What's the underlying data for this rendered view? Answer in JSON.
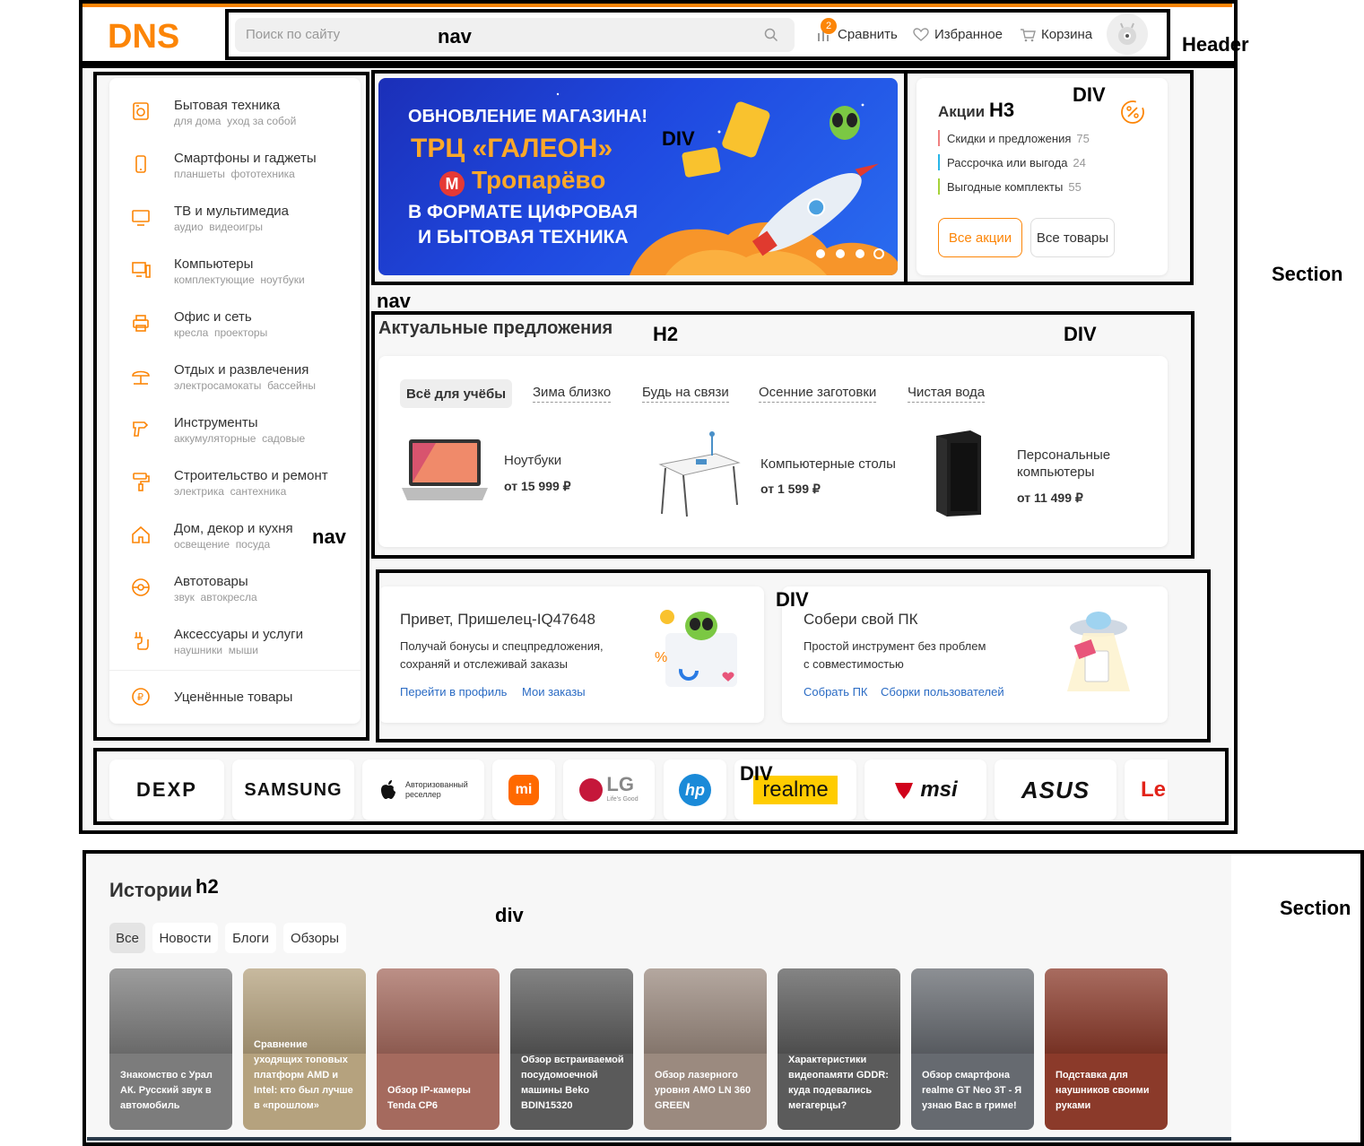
{
  "header": {
    "logo_text": "DNS",
    "search_placeholder": "Поиск по сайту",
    "compare_label": "Сравнить",
    "compare_count": "2",
    "favorites_label": "Избранное",
    "cart_label": "Корзина"
  },
  "catalog": {
    "items": [
      {
        "title": "Бытовая техника",
        "sub1": "для дома",
        "sub2": "уход за собой",
        "icon": "washing-machine-icon"
      },
      {
        "title": "Смартфоны и гаджеты",
        "sub1": "планшеты",
        "sub2": "фототехника",
        "icon": "smartphone-icon"
      },
      {
        "title": "ТВ и мультимедиа",
        "sub1": "аудио",
        "sub2": "видеоигры",
        "icon": "tv-icon"
      },
      {
        "title": "Компьютеры",
        "sub1": "комплектующие",
        "sub2": "ноутбуки",
        "icon": "computer-icon"
      },
      {
        "title": "Офис и сеть",
        "sub1": "кресла",
        "sub2": "проекторы",
        "icon": "printer-icon"
      },
      {
        "title": "Отдых и развлечения",
        "sub1": "электросамокаты",
        "sub2": "бассейны",
        "icon": "umbrella-icon"
      },
      {
        "title": "Инструменты",
        "sub1": "аккумуляторные",
        "sub2": "садовые",
        "icon": "drill-icon"
      },
      {
        "title": "Строительство и ремонт",
        "sub1": "электрика",
        "sub2": "сантехника",
        "icon": "paint-roller-icon"
      },
      {
        "title": "Дом, декор и кухня",
        "sub1": "освещение",
        "sub2": "посуда",
        "icon": "house-icon"
      },
      {
        "title": "Автотовары",
        "sub1": "звук",
        "sub2": "автокресла",
        "icon": "steering-wheel-icon"
      },
      {
        "title": "Аксессуары и услуги",
        "sub1": "наушники",
        "sub2": "мыши",
        "icon": "cable-icon"
      }
    ],
    "discount_label": "Уценённые товары"
  },
  "banner": {
    "line1": "ОБНОВЛЕНИЕ МАГАЗИНА!",
    "line2": "ТРЦ «ГАЛЕОН»",
    "metro_letter": "М",
    "line3": "Тропарёво",
    "line4": "В ФОРМАТЕ ЦИФРОВАЯ",
    "line5": "И БЫТОВАЯ ТЕХНИКА"
  },
  "promo": {
    "title": "Акции",
    "items": [
      {
        "label": "Скидки и предложения",
        "count": "75",
        "color": "#f08080"
      },
      {
        "label": "Рассрочка или выгода",
        "count": "24",
        "color": "#29b6e8"
      },
      {
        "label": "Выгодные комплекты",
        "count": "55",
        "color": "#a6d23a"
      }
    ],
    "all_promos_button": "Все акции",
    "all_goods_button": "Все товары"
  },
  "offers": {
    "title": "Актуальные предложения",
    "tabs": [
      "Всё для учёбы",
      "Зима близко",
      "Будь на связи",
      "Осенние заготовки",
      "Чистая вода"
    ],
    "products": [
      {
        "name": "Ноутбуки",
        "price": "от 15 999 ₽"
      },
      {
        "name": "Компьютерные столы",
        "price": "от 1 599 ₽"
      },
      {
        "name_line1": "Персональные",
        "name_line2": "компьютеры",
        "price": "от 11 499 ₽"
      }
    ]
  },
  "profile_card": {
    "title": "Привет, Пришелец-IQ47648",
    "text_line1": "Получай бонусы и спецпредложения,",
    "text_line2": "сохраняй и отслеживай заказы",
    "link1": "Перейти в профиль",
    "link2": "Мои заказы"
  },
  "pc_card": {
    "title": "Собери свой ПК",
    "text_line1": "Простой инструмент без проблем",
    "text_line2": "с совместимостью",
    "link1": "Собрать ПК",
    "link2": "Сборки пользователей"
  },
  "brands": {
    "dexp": "DEXP",
    "samsung": "SAMSUNG",
    "apple_text_1": "Авторизованный",
    "apple_text_2": "реселлер",
    "xiaomi": "mi",
    "lg": "LG",
    "lg_sub": "Life's Good",
    "hp": "hp",
    "realme": "realme",
    "msi": "msi",
    "asus": "ASUS",
    "lenovo": "Le"
  },
  "stories": {
    "title": "Истории",
    "tabs": [
      "Все",
      "Новости",
      "Блоги",
      "Обзоры"
    ],
    "items": [
      {
        "text": "Знакомство с Урал АК. Русский звук в автомобиль",
        "color": "#7c7c7c"
      },
      {
        "text": "Сравнение уходящих топовых платформ AMD и Intel: кто был лучше в «прошлом»",
        "color": "#b5a27e"
      },
      {
        "text": "Обзор IP-камеры Tenda CP6",
        "color": "#a56a5e"
      },
      {
        "text": "Обзор встраиваемой посудомоечной машины Beko BDIN15320",
        "color": "#5a5a5a"
      },
      {
        "text": "Обзор лазерного уровня AMO LN 360 GREEN",
        "color": "#9b8a7f"
      },
      {
        "text": "Характеристики видеопамяти GDDR: куда подевались мегагерцы?",
        "color": "#5b5b5b"
      },
      {
        "text": "Обзор смартфона realme GT Neo 3T - Я узнаю Вас в гриме!",
        "color": "#666a70"
      },
      {
        "text": "Подставка для наушников своими руками",
        "color": "#8b3a2a"
      }
    ]
  },
  "annotations": {
    "header": "Header",
    "nav_search": "nav",
    "section1": "Section",
    "div_banner": "DIV",
    "div_promo": "DIV",
    "h3": "H3",
    "nav_mid": "nav",
    "h2": "H2",
    "div_offers": "DIV",
    "nav_catalog": "nav",
    "div_cards": "DIV",
    "div_brands": "DIV",
    "section2": "Section",
    "h2_small": "h2",
    "div_stories": "div"
  }
}
